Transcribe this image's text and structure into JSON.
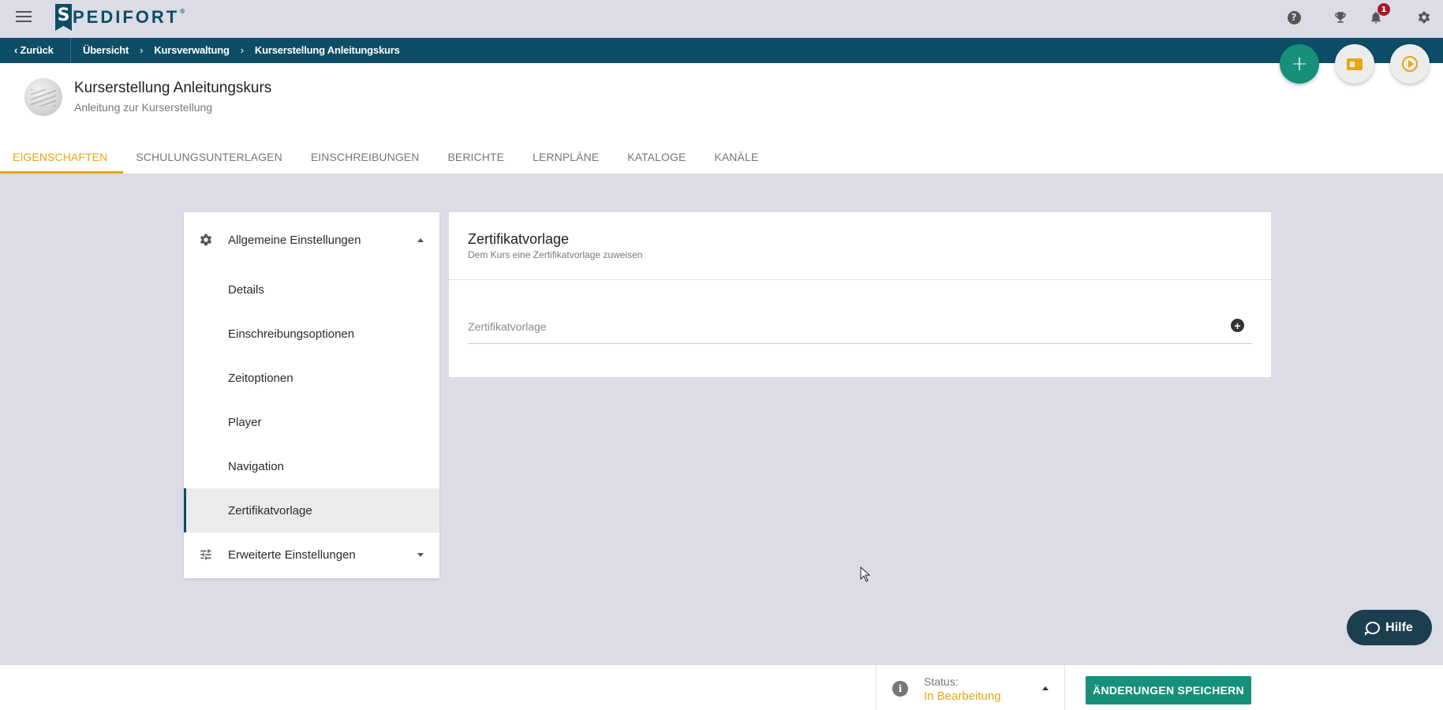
{
  "topbar": {
    "logo_letter": "S",
    "logo_text": "PEDIFORT",
    "logo_reg": "®",
    "notification_count": "1",
    "icons": [
      "help-icon",
      "trophy-icon",
      "bell-icon",
      "gear-icon"
    ]
  },
  "breadcrumb": {
    "back_label": "Zurück",
    "items": [
      "Übersicht",
      "Kursverwaltung",
      "Kurserstellung Anleitungskurs"
    ]
  },
  "course": {
    "title": "Kurserstellung Anleitungskurs",
    "subtitle": "Anleitung zur Kurserstellung"
  },
  "tabs": [
    {
      "label": "EIGENSCHAFTEN",
      "active": true
    },
    {
      "label": "SCHULUNGSUNTERLAGEN",
      "active": false
    },
    {
      "label": "EINSCHREIBUNGEN",
      "active": false
    },
    {
      "label": "BERICHTE",
      "active": false
    },
    {
      "label": "LERNPLÄNE",
      "active": false
    },
    {
      "label": "KATALOGE",
      "active": false
    },
    {
      "label": "KANÄLE",
      "active": false
    }
  ],
  "fabs": {
    "add_symbol": "+"
  },
  "settings_nav": {
    "group_general": "Allgemeine Einstellungen",
    "items": [
      "Details",
      "Einschreibungsoptionen",
      "Zeitoptionen",
      "Player",
      "Navigation",
      "Zertifikatvorlage"
    ],
    "active_item": "Zertifikatvorlage",
    "group_advanced": "Erweiterte Einstellungen"
  },
  "panel": {
    "title": "Zertifikatvorlage",
    "subtitle": "Dem Kurs eine Zertifikatvorlage zuweisen",
    "field_placeholder": "Zertifikatvorlage",
    "field_add_symbol": "+"
  },
  "help_button": {
    "label": "Hilfe"
  },
  "footer": {
    "info_symbol": "i",
    "status_label": "Status:",
    "status_value": "In Bearbeitung",
    "save_label": "ÄNDERUNGEN SPEICHERN"
  },
  "colors": {
    "brand": "#0d4d66",
    "accent": "#e8a612",
    "primary_action": "#17907a",
    "background": "#dcdce6",
    "notification": "#a3192d"
  }
}
